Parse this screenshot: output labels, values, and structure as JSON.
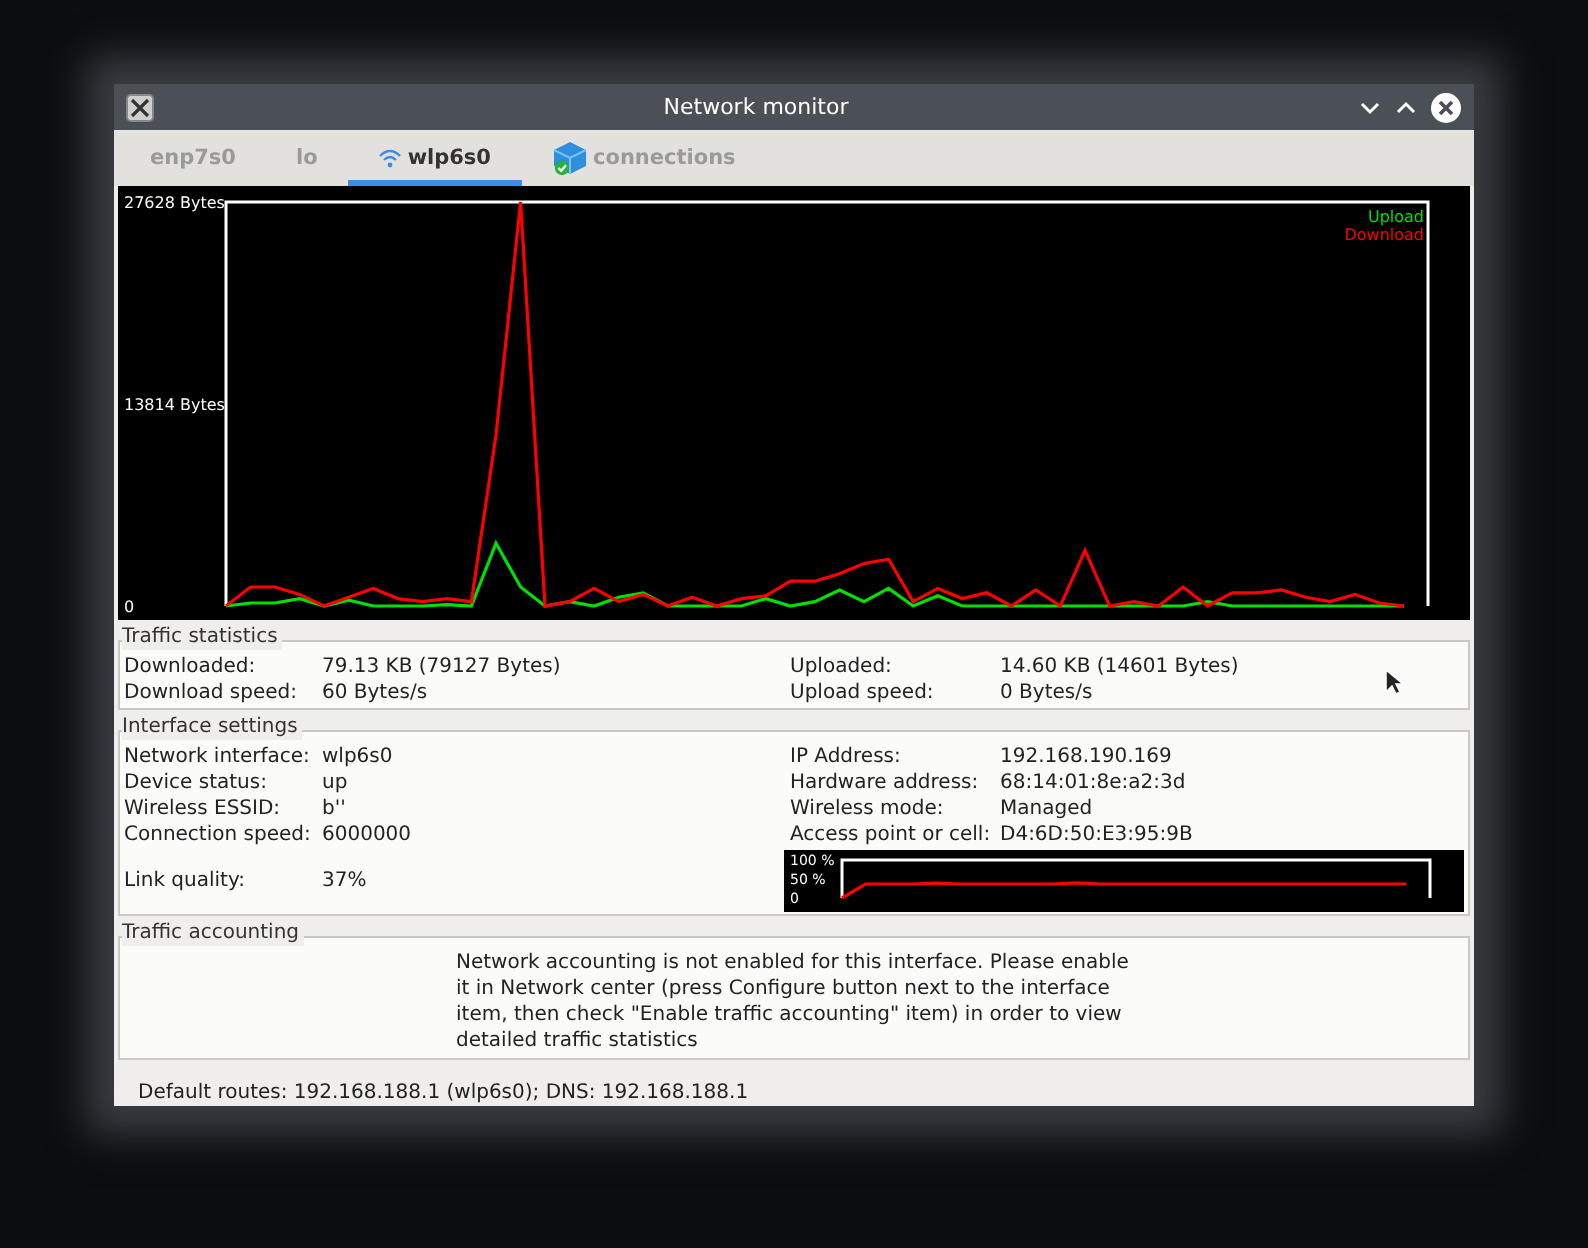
{
  "window": {
    "title": "Network monitor"
  },
  "tabs": [
    {
      "label": "enp7s0",
      "kind": "plain",
      "selected": false
    },
    {
      "label": "lo",
      "kind": "plain",
      "selected": false
    },
    {
      "label": "wlp6s0",
      "kind": "wireless",
      "selected": true
    },
    {
      "label": "connections",
      "kind": "connections",
      "selected": false
    }
  ],
  "traffic_chart": {
    "chart_data": {
      "type": "line",
      "ylim": [
        0,
        27628
      ],
      "yticks": [
        {
          "value": 0,
          "label": "0"
        },
        {
          "value": 13814,
          "label": "13814 Bytes"
        },
        {
          "value": 27628,
          "label": "27628 Bytes"
        }
      ],
      "series": [
        {
          "name": "Upload",
          "color": "#00e000",
          "values": [
            0,
            200,
            200,
            500,
            0,
            400,
            0,
            0,
            0,
            100,
            0,
            4300,
            1300,
            0,
            300,
            0,
            600,
            900,
            0,
            0,
            0,
            0,
            500,
            0,
            300,
            1100,
            300,
            1200,
            0,
            700,
            0,
            0,
            0,
            0,
            0,
            0,
            0,
            0,
            0,
            0,
            300,
            0,
            0,
            0,
            0,
            0,
            0,
            0,
            0
          ]
        },
        {
          "name": "Download",
          "color": "#ff0000",
          "values": [
            0,
            1300,
            1300,
            800,
            0,
            600,
            1200,
            500,
            300,
            500,
            300,
            11700,
            27628,
            0,
            300,
            1200,
            300,
            800,
            0,
            600,
            0,
            500,
            700,
            1700,
            1700,
            2200,
            2900,
            3200,
            300,
            1200,
            500,
            900,
            0,
            1100,
            0,
            3800,
            0,
            300,
            0,
            1300,
            0,
            900,
            900,
            1100,
            600,
            300,
            800,
            200,
            0
          ]
        }
      ]
    }
  },
  "traffic_statistics": {
    "title": "Traffic statistics",
    "left": [
      {
        "label": "Downloaded:",
        "value": "79.13 KB (79127 Bytes)"
      },
      {
        "label": "Download speed:",
        "value": "60 Bytes/s"
      }
    ],
    "right": [
      {
        "label": "Uploaded:",
        "value": "14.60 KB (14601 Bytes)"
      },
      {
        "label": "Upload speed:",
        "value": "0 Bytes/s"
      }
    ]
  },
  "interface_settings": {
    "title": "Interface settings",
    "left": [
      {
        "label": "Network interface:",
        "value": "wlp6s0"
      },
      {
        "label": "Device status:",
        "value": "up"
      },
      {
        "label": "Wireless ESSID:",
        "value": "b''"
      },
      {
        "label": "Connection speed:",
        "value": "6000000"
      }
    ],
    "right": [
      {
        "label": "IP Address:",
        "value": "192.168.190.169"
      },
      {
        "label": "Hardware address:",
        "value": "68:14:01:8e:a2:3d"
      },
      {
        "label": "Wireless mode:",
        "value": "Managed"
      },
      {
        "label": "Access point or cell:",
        "value": "D4:6D:50:E3:95:9B"
      }
    ],
    "link_quality": {
      "label": "Link quality:",
      "value": "37%",
      "chart_data": {
        "type": "line",
        "ylim": [
          0,
          100
        ],
        "yticks": [
          {
            "value": 0,
            "label": "0"
          },
          {
            "value": 50,
            "label": "50 %"
          },
          {
            "value": 100,
            "label": "100 %"
          }
        ],
        "series": [
          {
            "color": "#ff0000",
            "values": [
              0,
              37,
              37,
              37,
              39,
              37,
              37,
              37,
              37,
              37,
              40,
              37,
              37,
              37,
              37,
              37,
              37,
              37,
              37,
              37,
              37,
              37,
              37,
              37,
              37
            ]
          }
        ]
      }
    }
  },
  "traffic_accounting": {
    "title": "Traffic accounting",
    "message": "Network accounting is not enabled for this interface. Please enable it in Network center (press Configure button next to the interface item, then check \"Enable traffic accounting\" item) in order to view detailed traffic statistics"
  },
  "status_bar": "Default routes: 192.168.188.1 (wlp6s0); DNS: 192.168.188.1"
}
